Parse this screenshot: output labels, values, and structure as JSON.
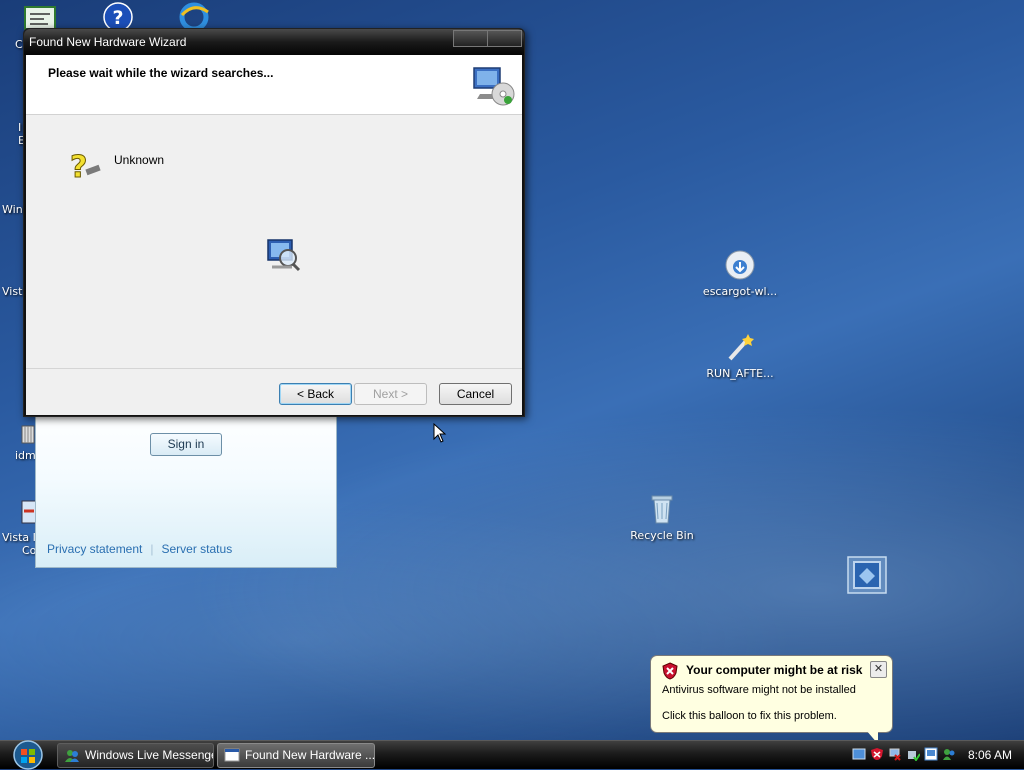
{
  "desktop": {
    "icons": [
      {
        "label": "escargot-wl..."
      },
      {
        "label": "RUN_AFTE..."
      },
      {
        "label": "Recycle Bin"
      }
    ],
    "edge_labels": [
      "C",
      "I",
      "E",
      "Windo",
      "Vista",
      "idma",
      "Vista I",
      "Co"
    ]
  },
  "messenger": {
    "signin_label": "Sign in",
    "privacy_link": "Privacy statement",
    "status_link": "Server status"
  },
  "wizard": {
    "title": "Found New Hardware Wizard",
    "header_text": "Please wait while the wizard searches...",
    "device_label": "Unknown",
    "back_label": "< Back",
    "next_label": "Next >",
    "cancel_label": "Cancel"
  },
  "balloon": {
    "title": "Your computer might be at risk",
    "line1": "Antivirus software might not be installed",
    "line2": "Click this balloon to fix this problem.",
    "close_glyph": "✕"
  },
  "taskbar": {
    "buttons": [
      {
        "label": "Windows Live Messenger"
      },
      {
        "label": "Found New Hardware ..."
      }
    ],
    "clock": "8:06 AM"
  }
}
